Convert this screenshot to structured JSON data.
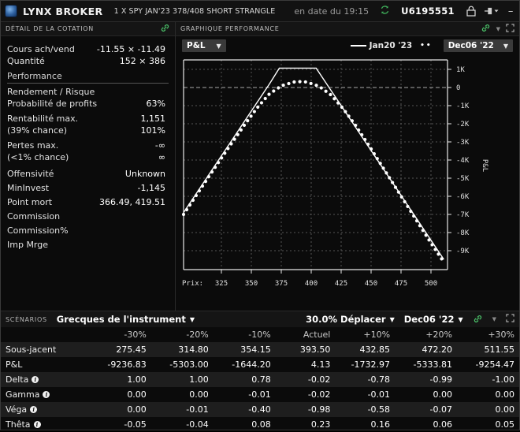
{
  "titlebar": {
    "brand": "LYNX BROKER",
    "instrument": "1 X SPY JAN'23 378/408 SHORT STRANGLE",
    "as_of": "en date du 19:15",
    "refresh_icon": "refresh-icon",
    "account": "U6195551",
    "lock_icon": "lock-icon",
    "pin_icon": "pin-icon",
    "minimize": "–",
    "maximize": "⛶",
    "close": "✕"
  },
  "quote_panel": {
    "title": "DÉTAIL DE LA COTATION",
    "link_icon": "link-icon",
    "rows": [
      {
        "label": "Cours ach/vend",
        "value": "-11.55 × -11.49",
        "band": "#2b2a12"
      },
      {
        "label": "Quantité",
        "value": "152 × 386",
        "band": "#2b2a12"
      }
    ],
    "section": "Performance",
    "perf": [
      {
        "label": "Rendement / Risque",
        "value": "",
        "band": "#0a0c33"
      },
      {
        "label": "Probabilité de profits",
        "value": "63%",
        "band": "#0a0c33"
      },
      {
        "label": "Rentabilité max.",
        "value": "1,151",
        "band": "#0b4512"
      },
      {
        "label": "(39% chance)",
        "value": "101%",
        "band": "#0b4512"
      },
      {
        "label": "Pertes max.",
        "value": "-∞",
        "band": "#8b0d0d"
      },
      {
        "label": "(<1% chance)",
        "value": "∞",
        "band": "#8b0d0d"
      }
    ],
    "extra": [
      {
        "label": "Offensivité",
        "value": "Unknown"
      },
      {
        "label": "MinInvest",
        "value": "-1,145"
      },
      {
        "label": "Point mort",
        "value": "366.49, 419.51"
      },
      {
        "label": "Commission",
        "value": ""
      },
      {
        "label": "Commission%",
        "value": ""
      },
      {
        "label": "Imp Mrge",
        "value": ""
      }
    ]
  },
  "chart_panel": {
    "title": "GRAPHIQUE PERFORMANCE",
    "link_icon": "link-icon",
    "caret_icon": "chevron-down-icon",
    "expand_icon": "expand-icon",
    "metric_select": "P&L",
    "legend_solid": "Jan20 '23",
    "legend_dotted": "Dec06 '22"
  },
  "chart_data": {
    "type": "line",
    "title": "GRAPHIQUE PERFORMANCE",
    "xlabel": "Prix:",
    "ylabel": "P&L",
    "xlim": [
      300,
      515
    ],
    "ylim": [
      -9800,
      1600
    ],
    "xticks": [
      325,
      350,
      375,
      400,
      425,
      450,
      475,
      500
    ],
    "yticks": [
      1000,
      0,
      -1000,
      -2000,
      -3000,
      -4000,
      -5000,
      -6000,
      -7000,
      -8000,
      -9000
    ],
    "ytick_labels": [
      "1K",
      "0",
      "-1K",
      "-2K",
      "-3K",
      "-4K",
      "-5K",
      "-6K",
      "-7K",
      "-8K",
      "-9K"
    ],
    "grid": true,
    "zero_line": true,
    "legend_position": "top-right",
    "series": [
      {
        "name": "Jan20 '23",
        "style": "solid",
        "color": "#ffffff",
        "x": [
          300,
          310,
          320,
          330,
          340,
          350,
          360,
          370,
          378,
          390,
          400,
          408,
          420,
          430,
          440,
          450,
          460,
          470,
          480,
          490,
          500,
          512
        ],
        "y": [
          -6700,
          -5700,
          -4700,
          -3700,
          -2700,
          -1700,
          -700,
          300,
          1151,
          1151,
          1151,
          1151,
          -49,
          -1049,
          -2049,
          -3049,
          -4049,
          -5049,
          -6049,
          -7049,
          -8049,
          -9249
        ]
      },
      {
        "name": "Dec06 '22",
        "style": "dotted",
        "color": "#ffffff",
        "x": [
          300,
          310,
          320,
          330,
          340,
          350,
          360,
          370,
          380,
          390,
          393.5,
          400,
          410,
          420,
          430,
          440,
          450,
          460,
          470,
          480,
          490,
          500,
          512
        ],
        "y": [
          -6800,
          -5800,
          -4800,
          -3820,
          -2850,
          -1900,
          -1000,
          -240,
          200,
          400,
          420,
          400,
          180,
          -300,
          -1050,
          -1950,
          -2950,
          -4000,
          -5050,
          -6100,
          -7150,
          -8200,
          -9400
        ]
      }
    ]
  },
  "scenarios": {
    "tag": "SCÉNARIOS",
    "selector": "Grecques de l'instrument",
    "move_select": "30.0% Déplacer",
    "date_select": "Dec06 '22",
    "link_icon": "link-icon",
    "caret_icon": "chevron-down-icon",
    "expand_icon": "expand-icon",
    "columns": [
      "",
      "-30%",
      "-20%",
      "-10%",
      "Actuel",
      "+10%",
      "+20%",
      "+30%"
    ],
    "rows": [
      {
        "label": "Sous-jacent",
        "info": false,
        "values": [
          "275.45",
          "314.80",
          "354.15",
          "393.50",
          "432.85",
          "472.20",
          "511.55"
        ]
      },
      {
        "label": "P&L",
        "info": false,
        "values": [
          "-9236.83",
          "-5303.00",
          "-1644.20",
          "4.13",
          "-1732.97",
          "-5333.81",
          "-9254.47"
        ]
      },
      {
        "label": "Delta",
        "info": true,
        "values": [
          "1.00",
          "1.00",
          "0.78",
          "-0.02",
          "-0.78",
          "-0.99",
          "-1.00"
        ]
      },
      {
        "label": "Gamma",
        "info": true,
        "values": [
          "0.00",
          "0.00",
          "-0.01",
          "-0.02",
          "-0.01",
          "0.00",
          "0.00"
        ]
      },
      {
        "label": "Véga",
        "info": true,
        "values": [
          "0.00",
          "-0.01",
          "-0.40",
          "-0.98",
          "-0.58",
          "-0.07",
          "0.00"
        ]
      },
      {
        "label": "Thêta",
        "info": true,
        "values": [
          "-0.05",
          "-0.04",
          "0.08",
          "0.23",
          "0.16",
          "0.06",
          "0.05"
        ]
      }
    ]
  }
}
